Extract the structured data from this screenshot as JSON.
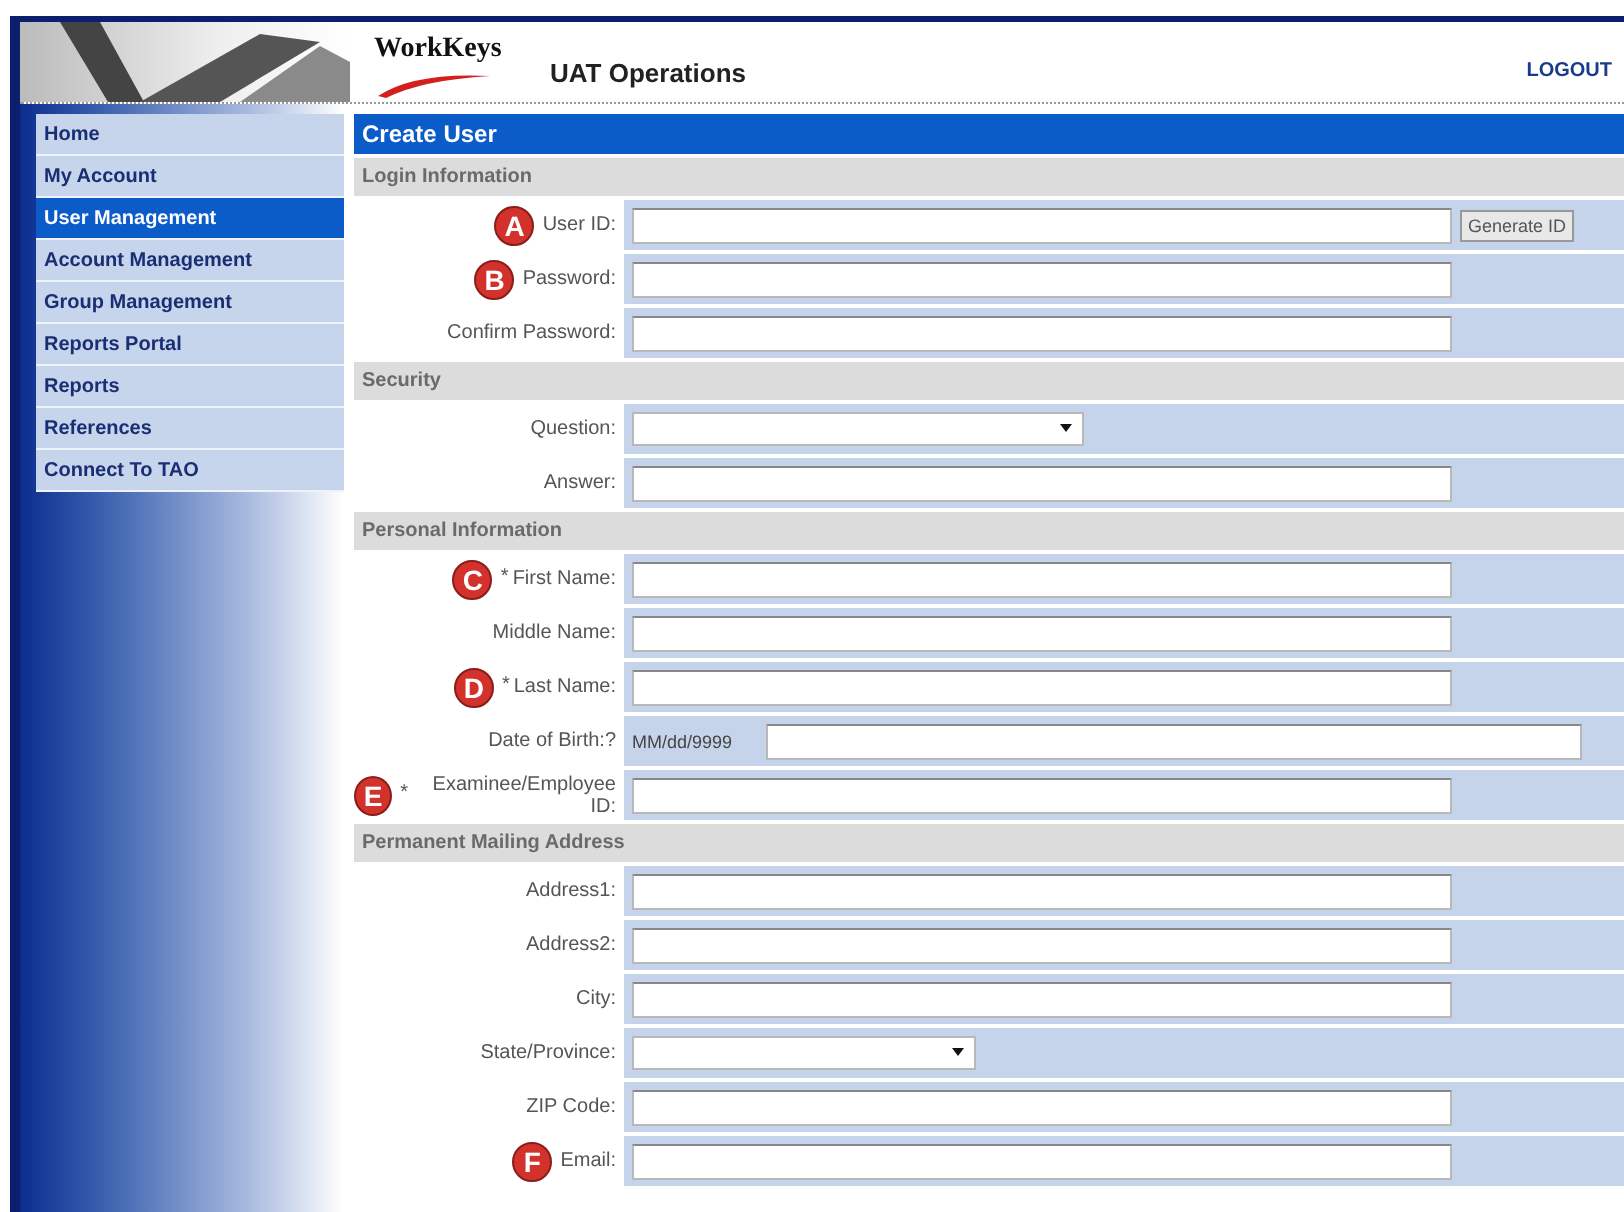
{
  "header": {
    "logo": "WorkKeys",
    "title": "UAT Operations",
    "logout": "LOGOUT"
  },
  "sidebar": {
    "items": [
      {
        "label": "Home",
        "selected": false
      },
      {
        "label": "My Account",
        "selected": false
      },
      {
        "label": "User Management",
        "selected": true
      },
      {
        "label": "Account Management",
        "selected": false
      },
      {
        "label": "Group Management",
        "selected": false
      },
      {
        "label": "Reports Portal",
        "selected": false
      },
      {
        "label": "Reports",
        "selected": false
      },
      {
        "label": "References",
        "selected": false
      },
      {
        "label": "Connect To TAO",
        "selected": false
      }
    ]
  },
  "form": {
    "title": "Create User",
    "sections": [
      {
        "heading": "Login Information",
        "rows": [
          {
            "kind": "text_button",
            "marker": "A",
            "label": "User ID:",
            "button": "Generate ID"
          },
          {
            "kind": "text",
            "marker": "B",
            "label": "Password:"
          },
          {
            "kind": "text",
            "label": "Confirm Password:"
          }
        ]
      },
      {
        "heading": "Security",
        "rows": [
          {
            "kind": "select",
            "label": "Question:"
          },
          {
            "kind": "text",
            "label": "Answer:"
          }
        ]
      },
      {
        "heading": "Personal Information",
        "rows": [
          {
            "kind": "text",
            "marker": "C",
            "required_mark": "*",
            "label": "First Name:"
          },
          {
            "kind": "text",
            "label": "Middle Name:"
          },
          {
            "kind": "text",
            "marker": "D",
            "required_mark": "*",
            "label": "Last Name:"
          },
          {
            "kind": "date",
            "label": "Date of Birth:?",
            "hint": "MM/dd/9999"
          },
          {
            "kind": "text",
            "marker": "E",
            "required_mark": "*",
            "label": "Examinee/Employee ID:"
          }
        ]
      },
      {
        "heading": "Permanent Mailing Address",
        "rows": [
          {
            "kind": "text",
            "label": "Address1:"
          },
          {
            "kind": "text",
            "label": "Address2:"
          },
          {
            "kind": "text",
            "label": "City:"
          },
          {
            "kind": "select_short",
            "label": "State/Province:"
          },
          {
            "kind": "text",
            "label": "ZIP Code:"
          },
          {
            "kind": "text",
            "marker": "F",
            "label": "Email:"
          }
        ]
      }
    ]
  }
}
